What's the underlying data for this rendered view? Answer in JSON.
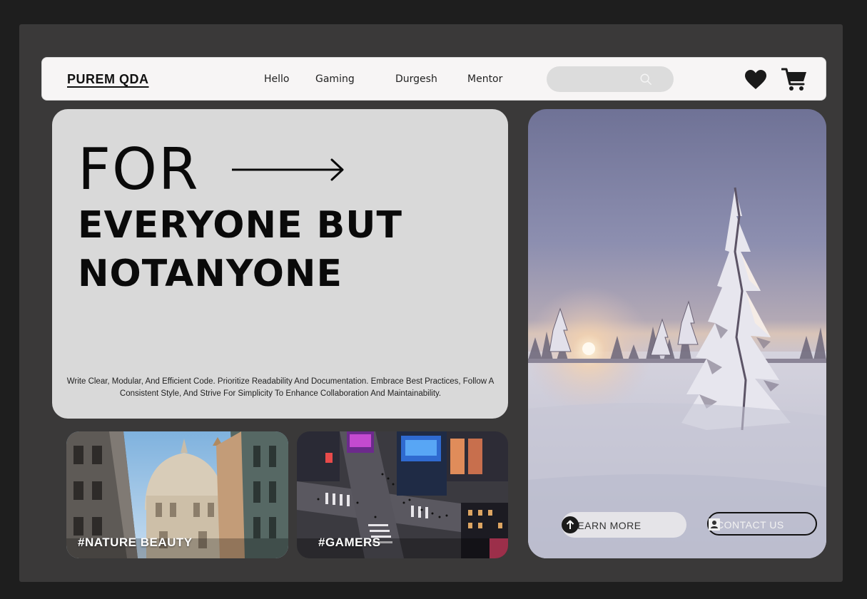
{
  "header": {
    "logo": "PUREM QDA",
    "nav": [
      "Hello",
      "Gaming",
      "Durgesh",
      "Mentor"
    ],
    "search": {
      "placeholder": "",
      "icon": "search-icon"
    },
    "icons": [
      "heart-icon",
      "cart-icon"
    ]
  },
  "hero": {
    "line1": "FOR",
    "line2": "EVERYONE BUT",
    "line3": "NOTANYONE",
    "description": "Write Clear, Modular, And Efficient Code. Prioritize Readability And Documentation. Embrace Best Practices, Follow A Consistent Style, And Strive For Simplicity To Enhance Collaboration And Maintainability."
  },
  "feature": {
    "learn_more": "LEARN MORE",
    "contact_us": "CONTACT US"
  },
  "cards": [
    {
      "tag": "#NATURE BEAUTY"
    },
    {
      "tag": "#GAMERS"
    }
  ],
  "colors": {
    "page_bg": "#1e1e1e",
    "frame_bg": "#3a3939",
    "navbar_bg": "#f7f5f5",
    "hero_bg": "#d9d9d9",
    "search_bg": "#dcdcdc"
  }
}
